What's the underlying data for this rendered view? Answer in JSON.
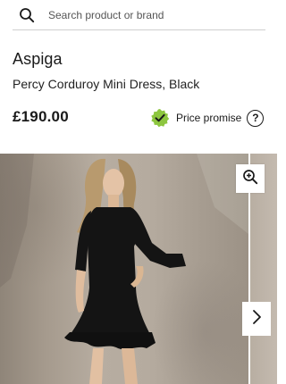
{
  "search": {
    "placeholder": "Search product or brand",
    "icon": "search-icon"
  },
  "product": {
    "brand": "Aspiga",
    "name": "Percy Corduroy Mini Dress, Black",
    "price": "£190.00"
  },
  "price_promise": {
    "label": "Price promise",
    "badge_icon": "check-badge-icon",
    "help_symbol": "?"
  },
  "gallery": {
    "zoom_icon": "zoom-in-icon",
    "next_icon": "chevron-right-icon"
  },
  "colors": {
    "badge_green": "#8dc63f",
    "text": "#1a1a1a",
    "divider": "#cfcfcf"
  }
}
